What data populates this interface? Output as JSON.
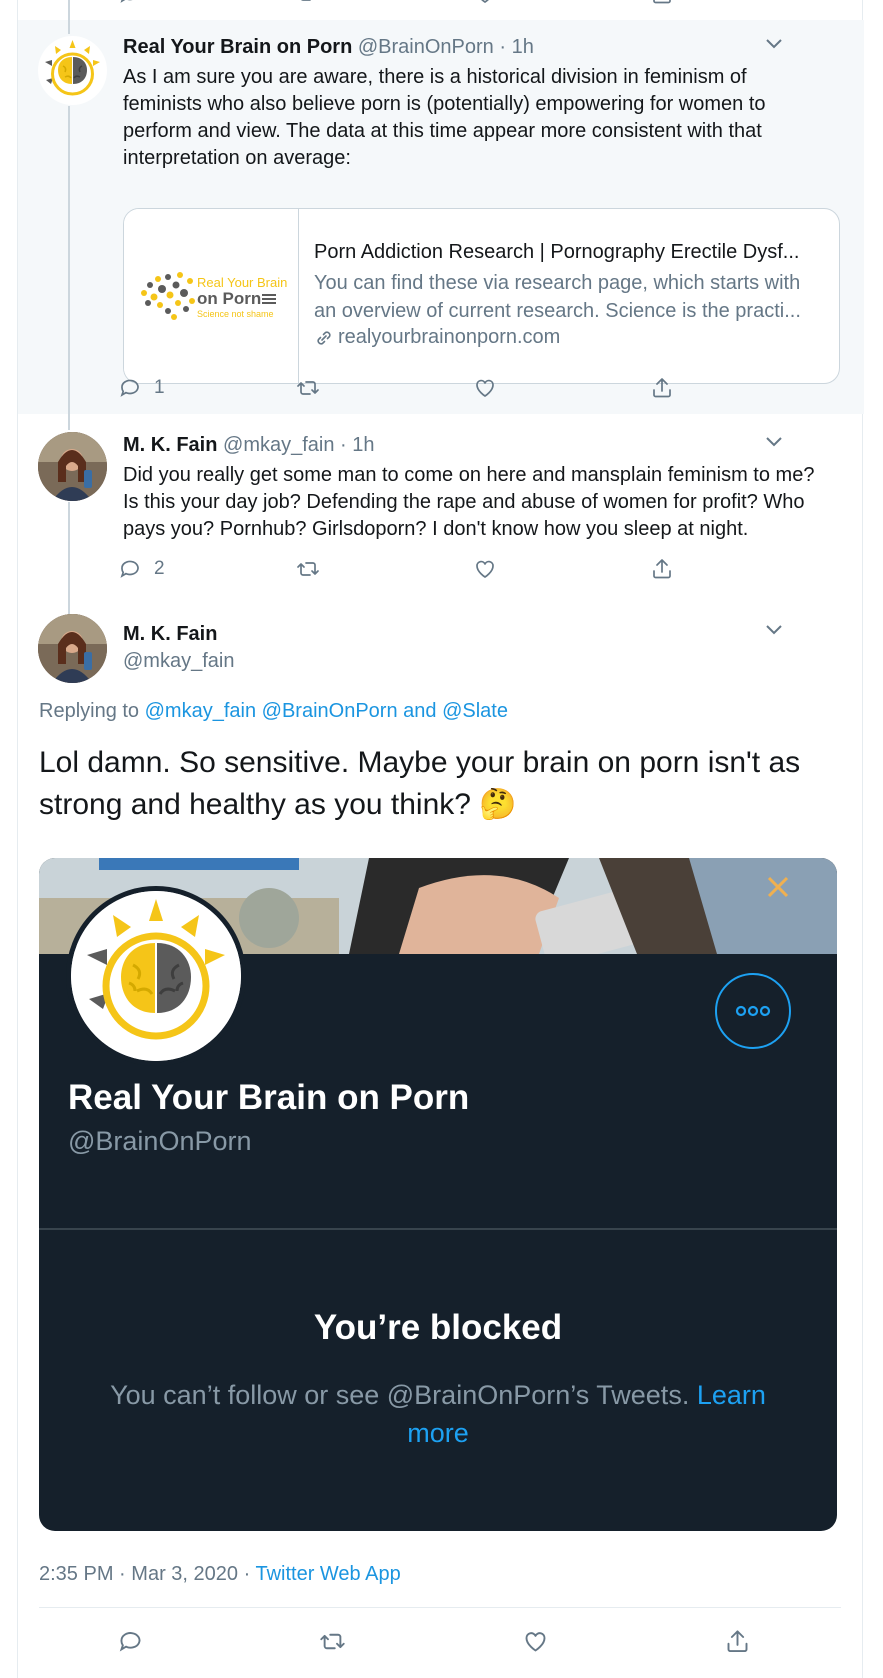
{
  "thread": {
    "reply1": {
      "name": "Real Your Brain on Porn",
      "handle": "@BrainOnPorn",
      "time": "1h",
      "text": "As I am sure you are aware, there is a historical division in feminism of feminists who also believe porn is (potentially) empowering for women to perform and view. The data at this time appear more consistent with that interpretation on average:",
      "card": {
        "logo_line1": "Real Your Brain",
        "logo_line2": "on Porn",
        "logo_tagline": "Science not shame",
        "title": "Porn Addiction Research | Pornography Erectile Dysf...",
        "description": "You can find these via research page, which starts with an overview of current research. Science is the practi...",
        "url": "realyourbrainonporn.com"
      },
      "reply_count": "1"
    },
    "reply2": {
      "name": "M. K. Fain",
      "handle": "@mkay_fain",
      "time": "1h",
      "text": "Did you really get some man to come on here and mansplain feminism to me? Is this your day job? Defending the rape and abuse of women for profit? Who pays you? Pornhub? Girlsdoporn? I don't know how you sleep at night.",
      "reply_count": "2"
    },
    "separator": "·"
  },
  "main_tweet": {
    "name": "M. K. Fain",
    "handle": "@mkay_fain",
    "replying_prefix": "Replying to",
    "replying_user1": "@mkay_fain",
    "replying_user2": "@BrainOnPorn",
    "replying_and": "and",
    "replying_user3": "@Slate",
    "text": "Lol damn. So sensitive. Maybe your brain on porn isn't as strong and healthy as you think? 🤔",
    "blocked_card": {
      "name": "Real Your Brain on Porn",
      "handle": "@BrainOnPorn",
      "title": "You’re blocked",
      "message": "You can’t follow or see @BrainOnPorn’s Tweets.",
      "learn_more": "Learn more"
    },
    "time": "2:35 PM",
    "date": "Mar 3, 2020",
    "source": "Twitter Web App"
  },
  "icons": [
    "reply-icon",
    "retweet-icon",
    "like-icon",
    "share-icon",
    "caret-down-icon",
    "link-icon",
    "more-icon"
  ],
  "colors": {
    "accent": "#1da1f2",
    "link": "#1b95e0",
    "secondary_text": "#657786",
    "highlight_bg": "#f5f8fa",
    "card_dark": "#15202b",
    "brain_yellow": "#f5c518",
    "brain_gray": "#5b5b5b"
  }
}
